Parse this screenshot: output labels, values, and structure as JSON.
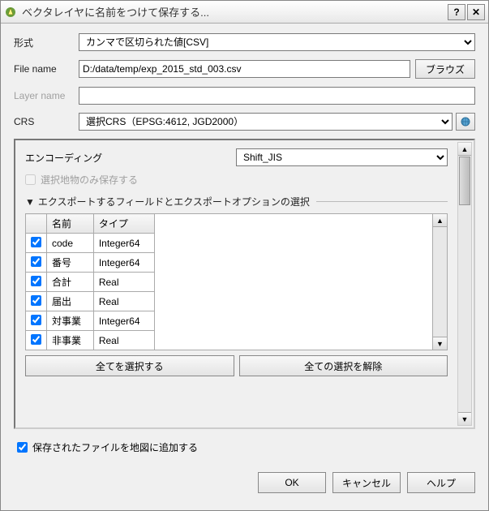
{
  "title": "ベクタレイヤに名前をつけて保存する...",
  "labels": {
    "format": "形式",
    "filename": "File name",
    "layername": "Layer name",
    "crs": "CRS",
    "encoding": "エンコーディング",
    "selected_only": "選択地物のみ保存する",
    "section": "エクスポートするフィールドとエクスポートオプションの選択",
    "col_name": "名前",
    "col_type": "タイプ",
    "select_all": "全てを選択する",
    "deselect_all": "全ての選択を解除",
    "add_to_map": "保存されたファイルを地図に追加する",
    "browse": "ブラウズ"
  },
  "values": {
    "format": "カンマで区切られた値[CSV]",
    "filename": "D:/data/temp/exp_2015_std_003.csv",
    "layername": "",
    "crs": "選択CRS（EPSG:4612, JGD2000）",
    "encoding": "Shift_JIS"
  },
  "fields": [
    {
      "name": "code",
      "type": "Integer64",
      "checked": true
    },
    {
      "name": "番号",
      "type": "Integer64",
      "checked": true
    },
    {
      "name": "合計",
      "type": "Real",
      "checked": true
    },
    {
      "name": "届出",
      "type": "Real",
      "checked": true
    },
    {
      "name": "対事業",
      "type": "Integer64",
      "checked": true
    },
    {
      "name": "非事業",
      "type": "Real",
      "checked": true
    }
  ],
  "buttons": {
    "ok": "OK",
    "cancel": "キャンセル",
    "help": "ヘルプ"
  }
}
